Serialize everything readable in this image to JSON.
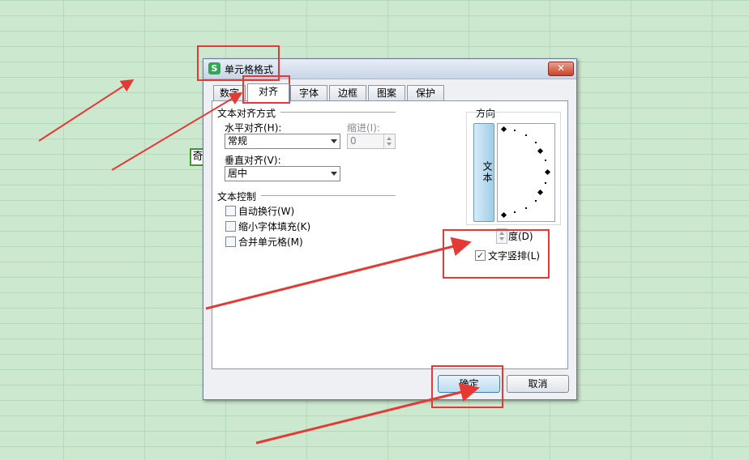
{
  "sheet": {
    "cell_char": "奇"
  },
  "dialog": {
    "title": "单元格格式",
    "app_logo": "S",
    "close_glyph": "✕",
    "tabs": [
      "数字",
      "对齐",
      "字体",
      "边框",
      "图案",
      "保护"
    ],
    "active_tab": "对齐",
    "text_alignment": {
      "group_label": "文本对齐方式",
      "horizontal_label": "水平对齐(H):",
      "horizontal_value": "常规",
      "indent_label": "缩进(I):",
      "indent_value": "0",
      "vertical_label": "垂直对齐(V):",
      "vertical_value": "居中"
    },
    "text_control": {
      "group_label": "文本控制",
      "options": [
        {
          "label": "自动换行(W)",
          "checked": false
        },
        {
          "label": "缩小字体填充(K)",
          "checked": false
        },
        {
          "label": "合并单元格(M)",
          "checked": false
        }
      ]
    },
    "orientation": {
      "group_label": "方向",
      "vertical_text_button": "文本",
      "degree_label": "度(D)",
      "vertical_text_checkbox_label": "文字竖排(L)",
      "vertical_text_checked": true
    },
    "ok_label": "确定",
    "cancel_label": "取消"
  },
  "annotations": {
    "color": "#e53935"
  }
}
